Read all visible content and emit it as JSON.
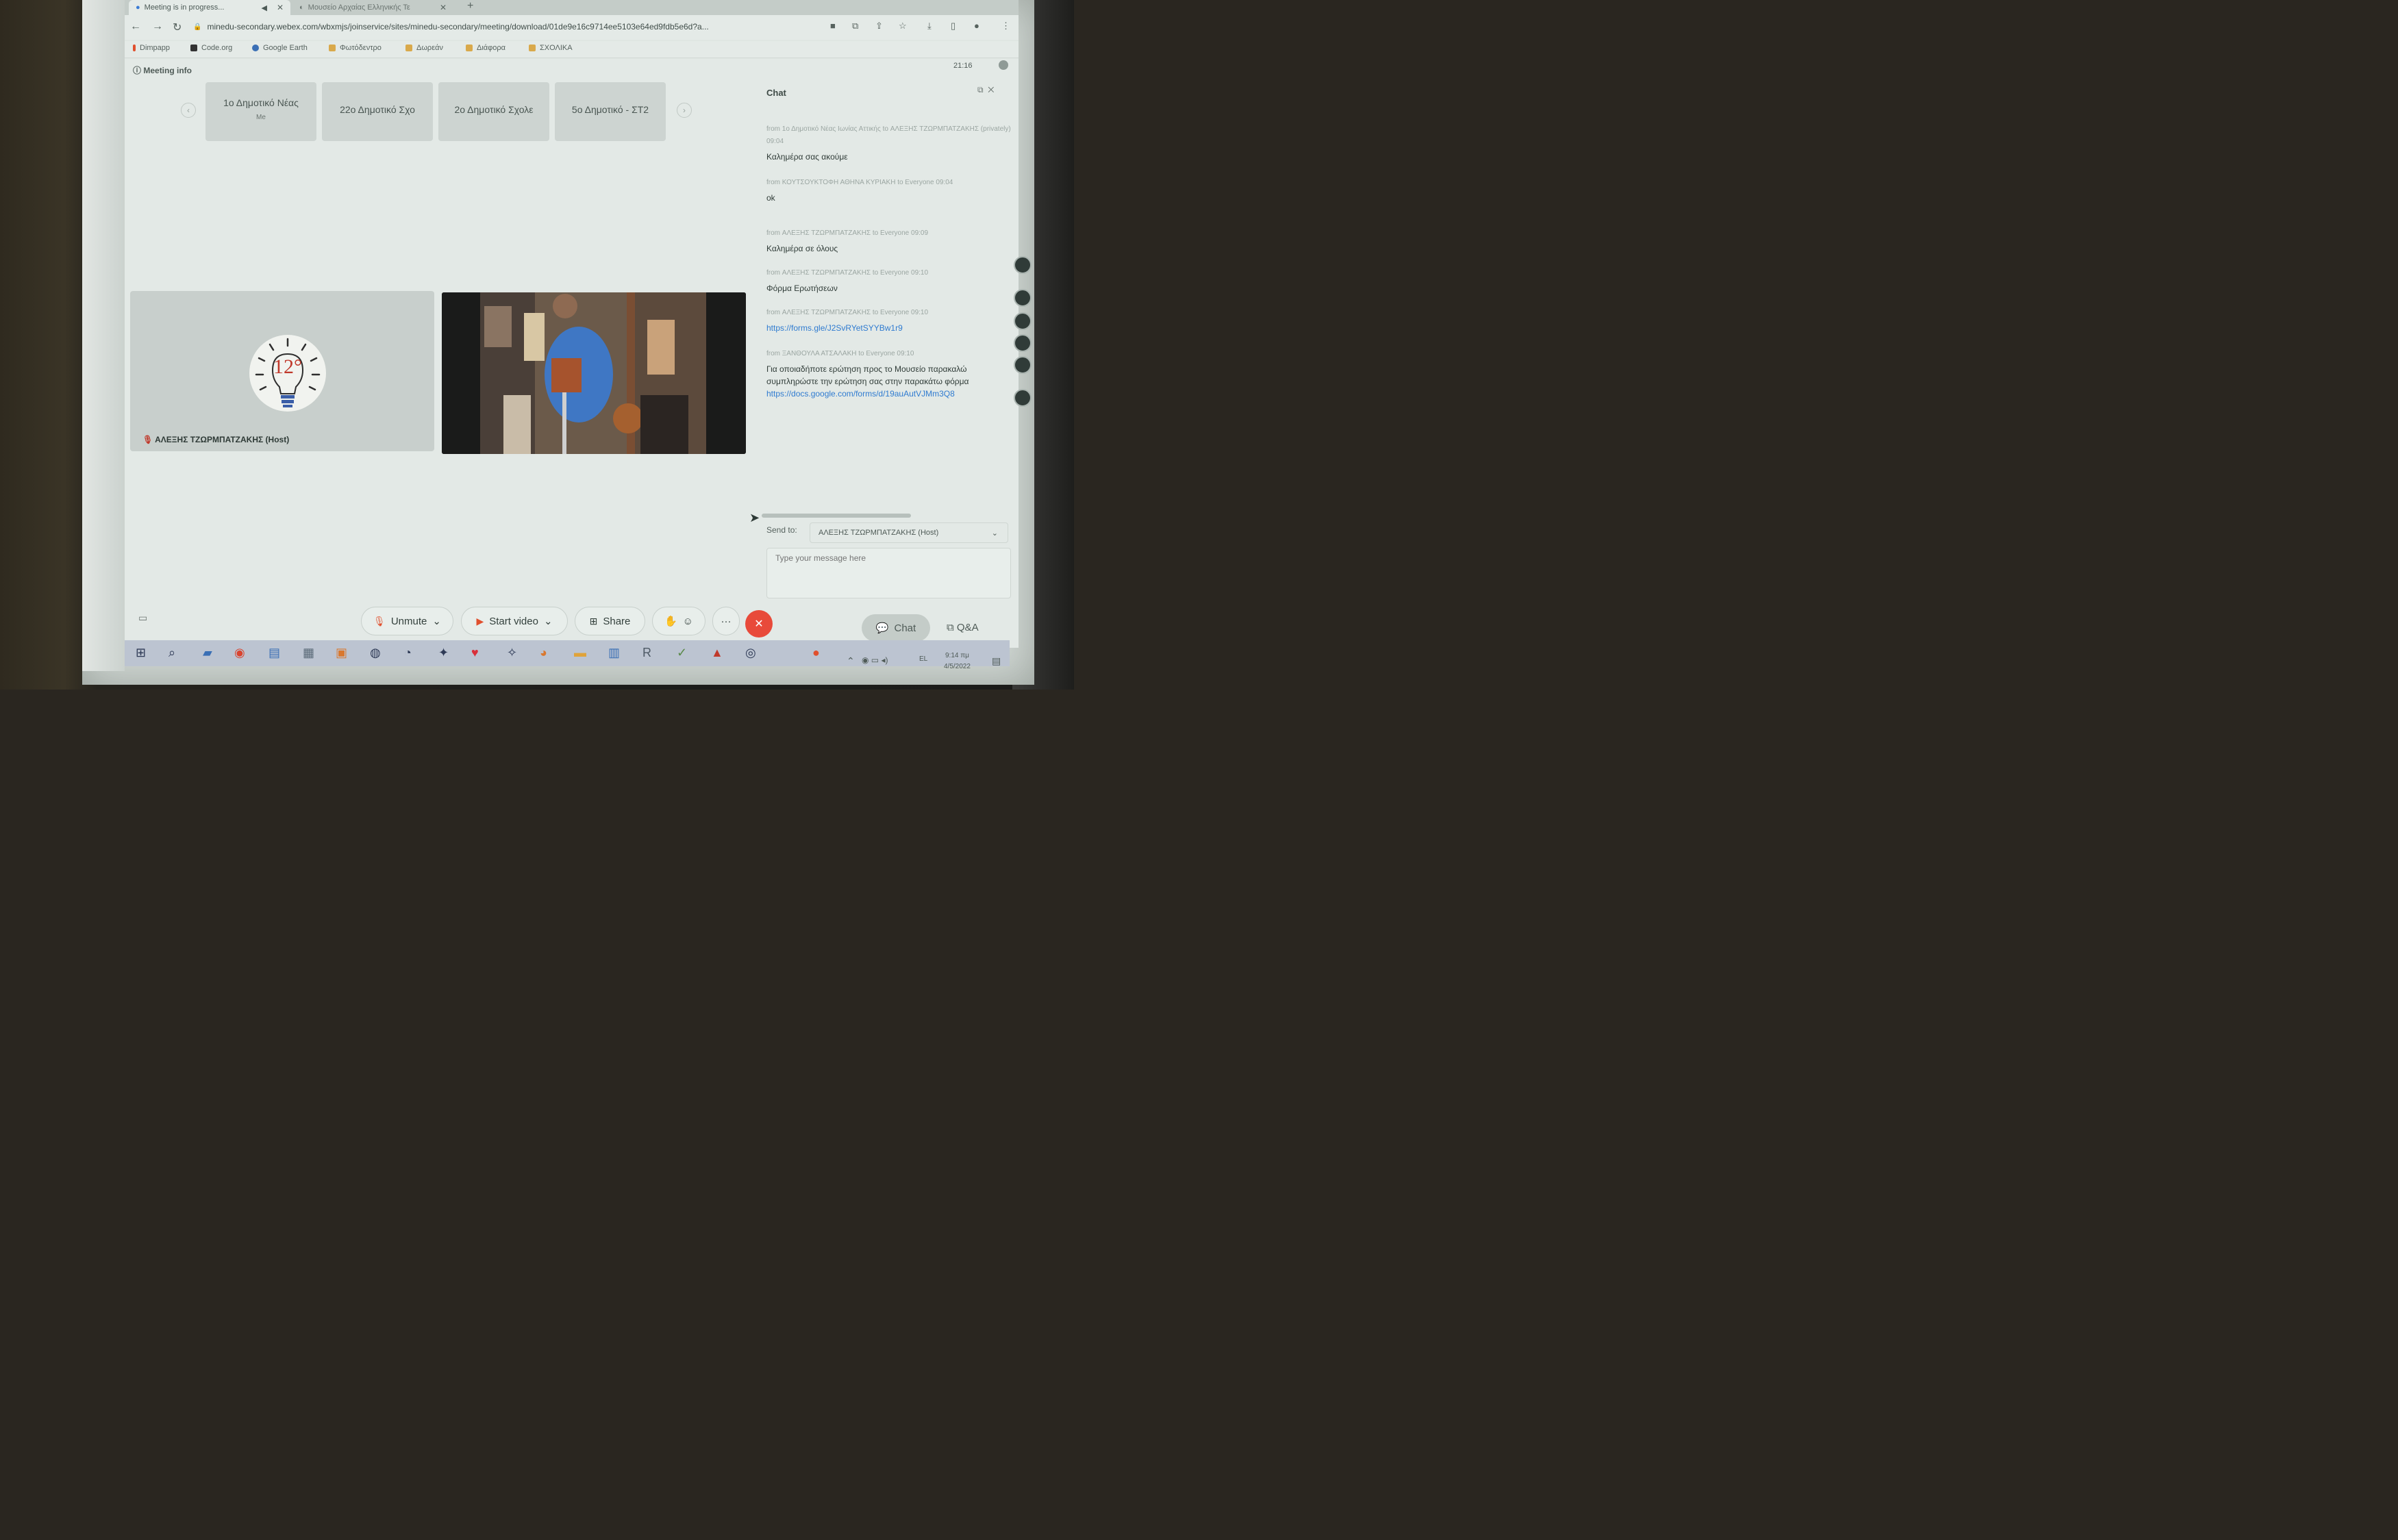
{
  "browser": {
    "tabs": [
      {
        "label": "Meeting is in progress...",
        "active": true
      },
      {
        "label": "Μουσείο Αρχαίας Ελληνικής Τε",
        "active": false
      }
    ],
    "url": "minedu-secondary.webex.com/wbxmjs/joinservice/sites/minedu-secondary/meeting/download/01de9e16c9714ee5103e64ed9fdb5e6d?a...",
    "bookmarks": [
      "Dimpapp",
      "Code.org",
      "Google Earth",
      "Φωτόδεντρο",
      "Δωρεάν",
      "Διάφορα",
      "ΣΧΟΛΙΚΑ"
    ]
  },
  "meeting": {
    "info_label": "Meeting info",
    "time": "21:16",
    "participants_strip": [
      {
        "name": "1ο Δημοτικό Νέας",
        "sub": "Me"
      },
      {
        "name": "22ο Δημοτικό Σχο",
        "sub": ""
      },
      {
        "name": "2ο Δημοτικό Σχολε",
        "sub": ""
      },
      {
        "name": "5ο Δημοτικό - ΣΤ2",
        "sub": ""
      }
    ],
    "host_tile_name": "ΑΛΕΞΗΣ ΤΖΩΡΜΠΑΤΖΑΚΗΣ (Host)",
    "host_logo_text": "12°"
  },
  "chat": {
    "title": "Chat",
    "messages": [
      {
        "meta": "from 1ο Δημοτικό Νέας Ιωνίας Αττικής to ΑΛΕΞΗΣ ΤΖΩΡΜΠΑΤΖΑΚΗΣ (privately)   09:04",
        "text": "Καλημέρα σας ακούμε",
        "link": ""
      },
      {
        "meta": "from ΚΟΥΤΣΟΥΚΤΟΦΗ ΑΘΗΝΑ ΚΥΡΙΑΚΗ to Everyone   09:04",
        "text": "ok",
        "link": ""
      },
      {
        "meta": "from ΑΛΕΞΗΣ ΤΖΩΡΜΠΑΤΖΑΚΗΣ to Everyone   09:09",
        "text": "Καλημέρα σε όλους",
        "link": ""
      },
      {
        "meta": "from ΑΛΕΞΗΣ ΤΖΩΡΜΠΑΤΖΑΚΗΣ to Everyone   09:10",
        "text": "Φόρμα Ερωτήσεων",
        "link": ""
      },
      {
        "meta": "from ΑΛΕΞΗΣ ΤΖΩΡΜΠΑΤΖΑΚΗΣ to Everyone   09:10",
        "text": "",
        "link": "https://forms.gle/J2SvRYetSYYBw1r9"
      },
      {
        "meta": "from ΞΑΝΘΟΥΛΑ ΑΤΣΑΛΑΚΗ to Everyone   09:10",
        "text": "Για οποιαδήποτε ερώτηση προς το Μουσείο παρακαλώ συμπληρώστε την ερώτηση σας στην παρακάτω φόρμα",
        "link": "https://docs.google.com/forms/d/19auAutVJMm3Q8"
      }
    ],
    "send_to_label": "Send to:",
    "send_to_value": "ΑΛΕΞΗΣ ΤΖΩΡΜΠΑΤΖΑΚΗΣ (Host)",
    "input_placeholder": "Type your message here"
  },
  "controls": {
    "unmute": "Unmute",
    "start_video": "Start video",
    "share": "Share",
    "more": "···",
    "chat": "Chat",
    "qa": "Q&A"
  },
  "taskbar": {
    "lang": "EL",
    "time": "9:14 πμ",
    "date": "4/5/2022"
  },
  "colors": {
    "end_button": "#e84a3a",
    "link": "#2f7bd0"
  }
}
